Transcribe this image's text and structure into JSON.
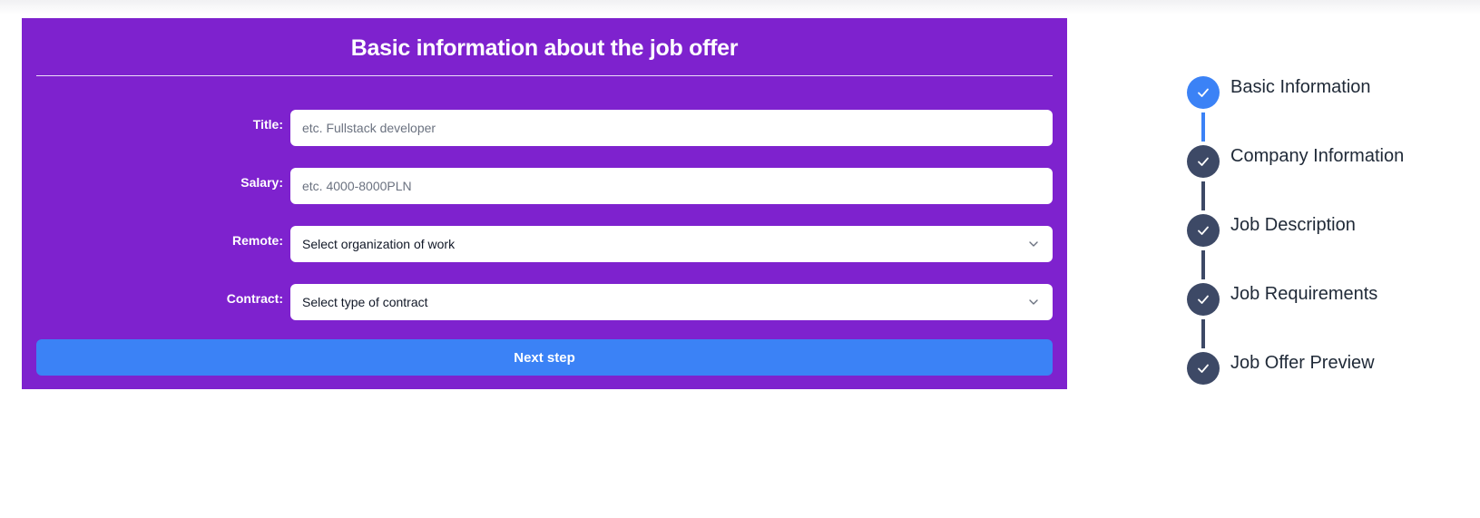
{
  "colors": {
    "card": "#7e22ce",
    "accent": "#3b82f6",
    "step_done": "#3d4966"
  },
  "form": {
    "title": "Basic information about the job offer",
    "fields": [
      {
        "label": "Title:",
        "type": "text",
        "placeholder": "etc. Fullstack developer",
        "value": ""
      },
      {
        "label": "Salary:",
        "type": "text",
        "placeholder": "etc. 4000-8000PLN",
        "value": ""
      },
      {
        "label": "Remote:",
        "type": "select",
        "selected": "Select organization of work",
        "icon": "chevron-down-icon"
      },
      {
        "label": "Contract:",
        "type": "select",
        "selected": "Select type of contract",
        "icon": "chevron-down-icon"
      }
    ],
    "next_button": "Next step"
  },
  "stepper": {
    "steps": [
      {
        "label": "Basic Information",
        "state": "current",
        "icon": "check-icon"
      },
      {
        "label": "Company Information",
        "state": "done",
        "icon": "check-icon"
      },
      {
        "label": "Job Description",
        "state": "done",
        "icon": "check-icon"
      },
      {
        "label": "Job Requirements",
        "state": "done",
        "icon": "check-icon"
      },
      {
        "label": "Job Offer Preview",
        "state": "done",
        "icon": "check-icon"
      }
    ]
  }
}
